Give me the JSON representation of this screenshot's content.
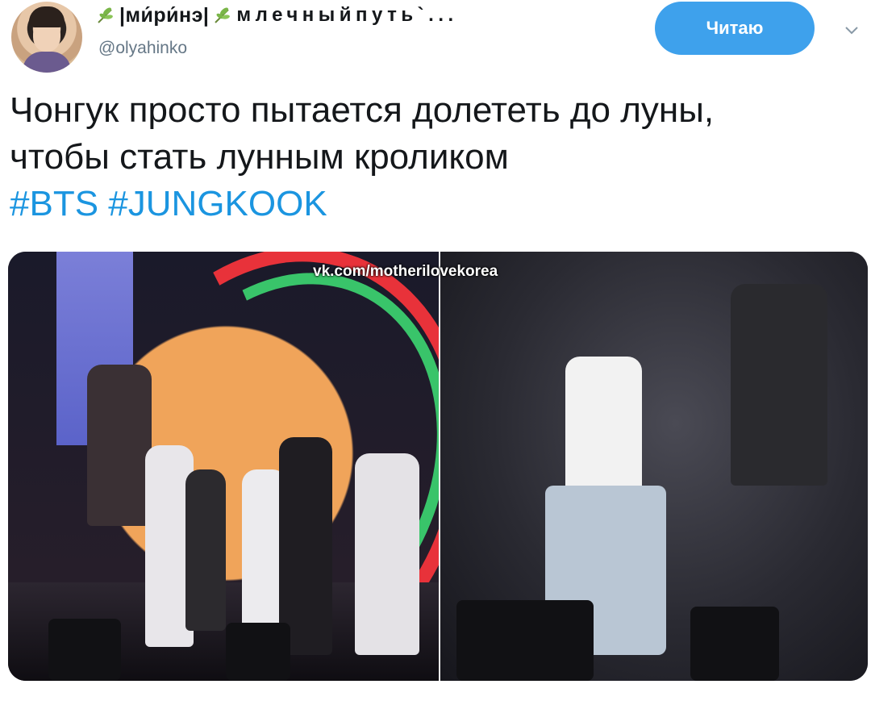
{
  "user": {
    "display_name_part1": "|ми́ри́нэ|",
    "display_name_part2": "млечныйпуть`...",
    "handle": "@olyahinko"
  },
  "actions": {
    "follow_label": "Читаю"
  },
  "tweet": {
    "line1": "Чонгук просто пытается долететь до луны,",
    "line2": "чтобы стать лунным кроликом",
    "hashtags": [
      "#BTS",
      "#JUNGKOOK"
    ]
  },
  "media": {
    "watermark": "vk.com/motherilovekorea"
  },
  "colors": {
    "accent": "#3ea1ec",
    "hashtag": "#1b95e0",
    "text": "#14171a",
    "secondary_text": "#657786"
  }
}
